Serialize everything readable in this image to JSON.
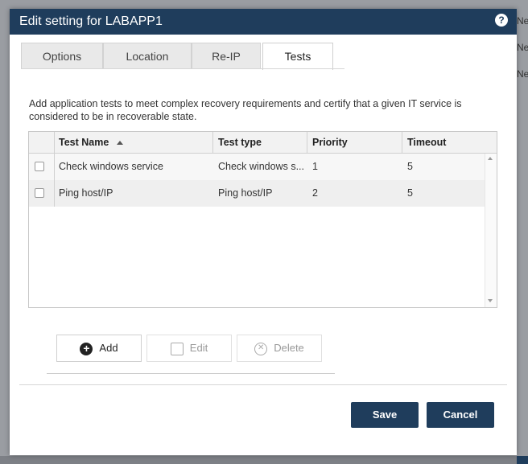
{
  "background": {
    "side_labels": [
      "Ne",
      "Ne",
      "Ne"
    ]
  },
  "dialog": {
    "title": "Edit setting for LABAPP1",
    "help_icon": "?",
    "tabs": [
      {
        "label": "Options"
      },
      {
        "label": "Location"
      },
      {
        "label": "Re-IP"
      },
      {
        "label": "Tests",
        "active": true
      }
    ],
    "description": "Add application tests to meet complex recovery requirements and certify that a given IT service is considered to be in recoverable state.",
    "grid": {
      "columns": [
        "Test Name",
        "Test type",
        "Priority",
        "Timeout"
      ],
      "sort_column": "Test Name",
      "sort_direction": "ascending",
      "rows": [
        {
          "name": "Check windows service",
          "type": "Check windows s...",
          "priority": "1",
          "timeout": "5"
        },
        {
          "name": "Ping host/IP",
          "type": "Ping host/IP",
          "priority": "2",
          "timeout": "5"
        }
      ]
    },
    "buttons": {
      "add": "Add",
      "edit": "Edit",
      "delete": "Delete",
      "save": "Save",
      "cancel": "Cancel"
    },
    "colors": {
      "titlebar": "#1f3d5c",
      "primary_button": "#1f3d5c"
    }
  }
}
